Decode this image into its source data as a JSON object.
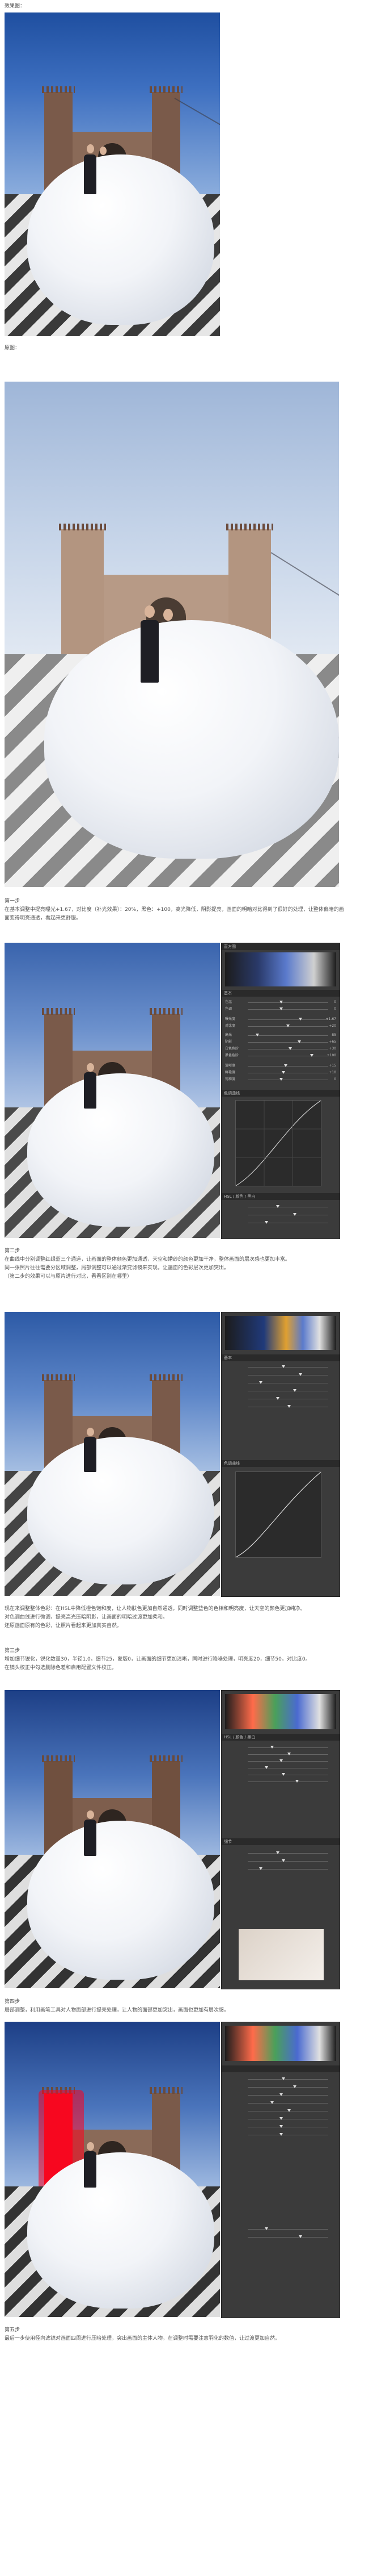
{
  "captions": {
    "after": "效果图：",
    "before": "原图："
  },
  "steps": {
    "s1_title": "第一步",
    "s1_p1": "在基本调整中提亮曝光+1.67，对比度（补光效果）：20%，黑色：+100，高光降低，阴影提亮，画面的明暗对比得到了很好的处理，让整体偏暗的画面变得明亮通透，看起来更舒服。",
    "s2_title": "第二步",
    "s2_p1": "在曲线中分别调整红绿蓝三个通道，让画面的整体颜色更加通透，天空和婚纱的颜色更加干净，整体画面的层次感也更加丰富。",
    "s2_p2": "同一张照片往往需要分区域调整，局部调整可以通过渐变滤镜来实现，让画面的色彩层次更加突出。",
    "s2_p3": "（第二步的效果可以与原片进行对比，看看区别在哪里）",
    "s2_p4": "现在来调整整体色彩：在HSL中降低橙色饱和度，让人物肤色更加自然通透，同时调整蓝色的色相和明亮度，让天空的颜色更加纯净。",
    "s2_p5": "对色调曲线进行微调，提亮高光压暗阴影，让画面的明暗过渡更加柔和。",
    "s2_p6": "还原画面原有的色彩，让照片看起来更加真实自然。",
    "s3_title": "第三步",
    "s3_p1": "增加细节锐化，锐化数量30，半径1.0，细节25，蒙版0，让画面的细节更加清晰，同时进行降噪处理，明亮度20，细节50，对比度0。",
    "s3_p2": "在镜头校正中勾选删除色差和启用配置文件校正。",
    "s4_title": "第四步",
    "s4_p1": "局部调整，利用画笔工具对人物面部进行提亮处理，让人物的面部更加突出，画面也更加有层次感。",
    "s5_title": "第五步",
    "s5_p1": "最后一步使用径向滤镜对画面四周进行压暗处理，突出画面的主体人物。在调整时需要注意羽化的数值，让过渡更加自然。"
  },
  "panel": {
    "header_left": "直方图",
    "header_right": "基本",
    "section_basic": "基本",
    "section_curve": "色调曲线",
    "section_hsl": "HSL / 颜色 / 黑白",
    "section_detail": "细节",
    "sliders": [
      {
        "label": "色温",
        "value": "0"
      },
      {
        "label": "色调",
        "value": "0"
      },
      {
        "label": "曝光度",
        "value": "+1.67"
      },
      {
        "label": "对比度",
        "value": "+20"
      },
      {
        "label": "高光",
        "value": "-85"
      },
      {
        "label": "阴影",
        "value": "+65"
      },
      {
        "label": "白色色阶",
        "value": "+30"
      },
      {
        "label": "黑色色阶",
        "value": "+100"
      },
      {
        "label": "清晰度",
        "value": "+15"
      },
      {
        "label": "鲜艳度",
        "value": "+10"
      },
      {
        "label": "饱和度",
        "value": "0"
      }
    ]
  }
}
